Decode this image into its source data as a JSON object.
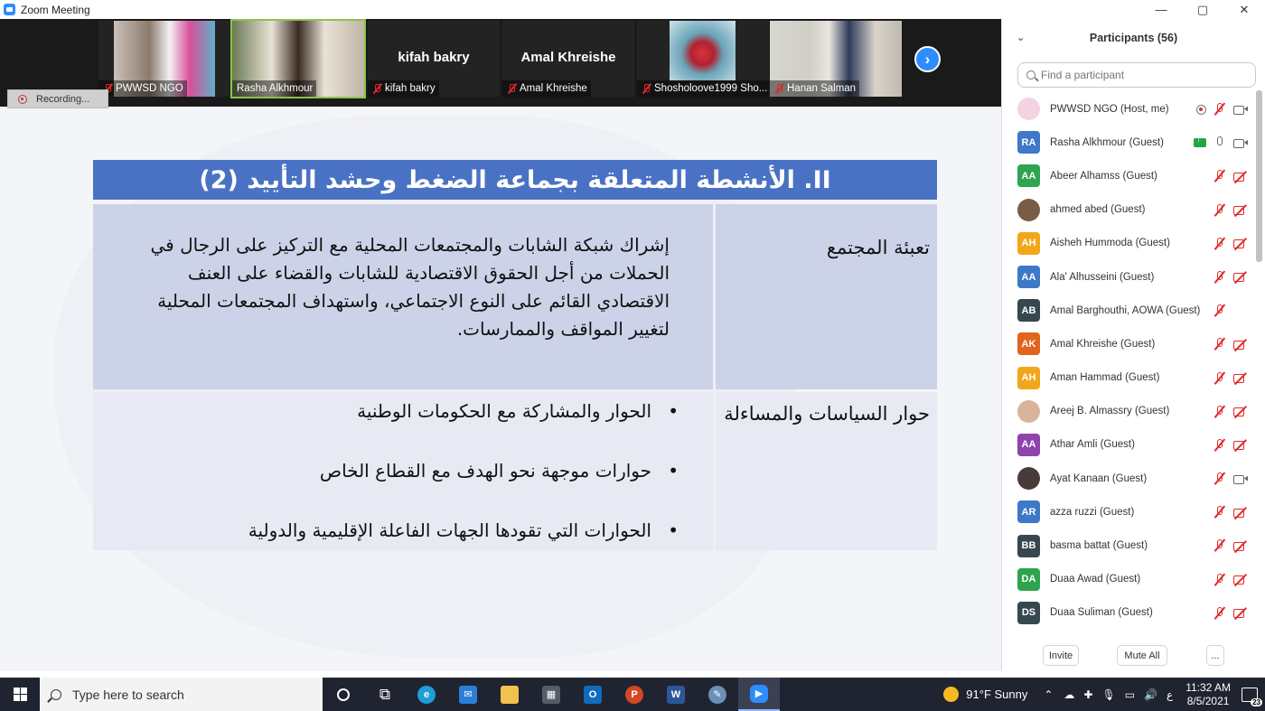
{
  "window": {
    "title": "Zoom Meeting",
    "controls": [
      "—",
      "▢",
      "✕"
    ]
  },
  "recording": {
    "label": "Recording..."
  },
  "gallery": {
    "tiles": [
      {
        "name": "PWWSD NGO",
        "type": "video",
        "speaking": false
      },
      {
        "name": "Rasha Alkhmour",
        "type": "video",
        "speaking": true
      },
      {
        "name": "kifah bakry",
        "type": "name",
        "speaking": false
      },
      {
        "name": "Amal Khreishe",
        "type": "name",
        "speaking": false
      },
      {
        "name": "Shosholoove1999 Sho...",
        "type": "image",
        "speaking": false
      },
      {
        "name": "Hanan Salman",
        "type": "video",
        "speaking": false
      }
    ],
    "next_icon": "chevron-right-icon"
  },
  "slide": {
    "header": "II. الأنشطة المتعلقة بجماعة الضغط وحشد التأييد (2)",
    "rows": [
      {
        "key": "تعبئة المجتمع",
        "value": "إشراك شبكة الشابات والمجتمعات المحلية مع التركيز على الرجال في الحملات من أجل الحقوق الاقتصادية للشابات والقضاء على العنف الاقتصادي القائم على النوع الاجتماعي، واستهداف المجتمعات المحلية لتغيير المواقف والممارسات."
      },
      {
        "key": "حوار السياسات والمساءلة",
        "bullets": [
          "الحوار والمشاركة مع الحكومات الوطنية",
          "حوارات موجهة نحو الهدف مع القطاع الخاص",
          "الحوارات التي تقودها الجهات الفاعلة الإقليمية والدولية"
        ]
      }
    ]
  },
  "participants": {
    "title": "Participants (56)",
    "search_placeholder": "Find a participant",
    "list": [
      {
        "initials": "",
        "name": "PWWSD NGO (Host, me)",
        "color": "#f3d2e1",
        "photo": true,
        "rec": true,
        "share": false,
        "mic": "off",
        "video": "on"
      },
      {
        "initials": "RA",
        "name": "Rasha Alkhmour (Guest)",
        "color": "#3f78c8",
        "photo": false,
        "rec": false,
        "share": true,
        "mic": "on",
        "video": "on"
      },
      {
        "initials": "AA",
        "name": "Abeer Alhamss (Guest)",
        "color": "#2ea44f",
        "photo": false,
        "rec": false,
        "share": false,
        "mic": "off",
        "video": "off"
      },
      {
        "initials": "",
        "name": "ahmed abed (Guest)",
        "color": "#7a5b44",
        "photo": true,
        "rec": false,
        "share": false,
        "mic": "off",
        "video": "off"
      },
      {
        "initials": "AH",
        "name": "Aisheh Hummoda (Guest)",
        "color": "#f2a71b",
        "photo": false,
        "rec": false,
        "share": false,
        "mic": "off",
        "video": "off"
      },
      {
        "initials": "AA",
        "name": "Ala' Alhusseini (Guest)",
        "color": "#3f78c8",
        "photo": false,
        "rec": false,
        "share": false,
        "mic": "off",
        "video": "off"
      },
      {
        "initials": "AB",
        "name": "Amal Barghouthi, AOWA (Guest)",
        "color": "#37474f",
        "photo": false,
        "rec": false,
        "share": false,
        "mic": "off",
        "video": "none"
      },
      {
        "initials": "AK",
        "name": "Amal Khreishe (Guest)",
        "color": "#e0651f",
        "photo": false,
        "rec": false,
        "share": false,
        "mic": "off",
        "video": "off"
      },
      {
        "initials": "AH",
        "name": "Aman Hammad (Guest)",
        "color": "#f2a71b",
        "photo": false,
        "rec": false,
        "share": false,
        "mic": "off",
        "video": "off"
      },
      {
        "initials": "",
        "name": "Areej B. Almassry (Guest)",
        "color": "#d9b49a",
        "photo": true,
        "rec": false,
        "share": false,
        "mic": "off",
        "video": "off"
      },
      {
        "initials": "AA",
        "name": "Athar Amli (Guest)",
        "color": "#8e44ad",
        "photo": false,
        "rec": false,
        "share": false,
        "mic": "off",
        "video": "off"
      },
      {
        "initials": "",
        "name": "Ayat Kanaan (Guest)",
        "color": "#4a3b3b",
        "photo": true,
        "rec": false,
        "share": false,
        "mic": "off",
        "video": "on"
      },
      {
        "initials": "AR",
        "name": "azza ruzzi (Guest)",
        "color": "#3f78c8",
        "photo": false,
        "rec": false,
        "share": false,
        "mic": "off",
        "video": "off"
      },
      {
        "initials": "BB",
        "name": "basma battat (Guest)",
        "color": "#37474f",
        "photo": false,
        "rec": false,
        "share": false,
        "mic": "off",
        "video": "off"
      },
      {
        "initials": "DA",
        "name": "Duaa Awad (Guest)",
        "color": "#2ea44f",
        "photo": false,
        "rec": false,
        "share": false,
        "mic": "off",
        "video": "off"
      },
      {
        "initials": "DS",
        "name": "Duaa Suliman (Guest)",
        "color": "#37474f",
        "photo": false,
        "rec": false,
        "share": false,
        "mic": "off",
        "video": "off"
      }
    ],
    "footer": {
      "invite": "Invite",
      "mute_all": "Mute All",
      "more": "..."
    }
  },
  "taskbar": {
    "search_placeholder": "Type here to search",
    "weather": "91°F  Sunny",
    "time": "11:32 AM",
    "date": "8/5/2021",
    "lang": "ع",
    "notifications": "23"
  }
}
